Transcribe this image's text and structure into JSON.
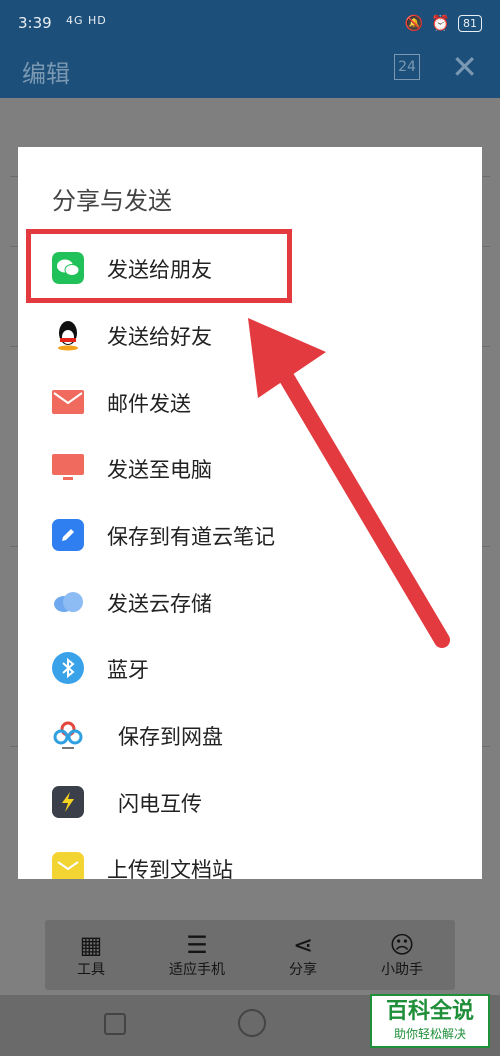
{
  "status_bar": {
    "time": "3:39",
    "signal": "4G HD",
    "battery": "81"
  },
  "header": {
    "title": "编辑",
    "badge": "24",
    "close_icon": "close-icon"
  },
  "dialog": {
    "title": "分享与发送",
    "items": [
      {
        "label": "发送给朋友",
        "icon": "wechat-icon",
        "color": "#21c15a"
      },
      {
        "label": "发送给好友",
        "icon": "qq-penguin-icon",
        "color": "#111111"
      },
      {
        "label": "邮件发送",
        "icon": "mail-icon",
        "color": "#f06a5d"
      },
      {
        "label": "发送至电脑",
        "icon": "computer-icon",
        "color": "#f06a5d"
      },
      {
        "label": "保存到有道云笔记",
        "icon": "youdao-note-icon",
        "color": "#2f7ff0"
      },
      {
        "label": "发送云存储",
        "icon": "cloud-icon",
        "color": "#6ea9f0"
      },
      {
        "label": "蓝牙",
        "icon": "bluetooth-icon",
        "color": "#3aa2e8"
      },
      {
        "label": "保存到网盘",
        "icon": "netdisk-icon",
        "color": "#2fa0e0"
      },
      {
        "label": "闪电互传",
        "icon": "lightning-icon",
        "color": "#3b3f4a"
      },
      {
        "label": "上传到文档站",
        "icon": "upload-icon",
        "color": "#f2d533"
      }
    ]
  },
  "toolbar": {
    "items": [
      {
        "label": "工具",
        "icon": "grid-icon"
      },
      {
        "label": "适应手机",
        "icon": "fit-icon"
      },
      {
        "label": "分享",
        "icon": "share-icon"
      },
      {
        "label": "小助手",
        "icon": "assistant-icon"
      }
    ]
  },
  "watermark": {
    "title": "百科全说",
    "subtitle": "助你轻松解决"
  },
  "colors": {
    "annotation": "#e33a3f",
    "header": "#1c4f7a"
  }
}
